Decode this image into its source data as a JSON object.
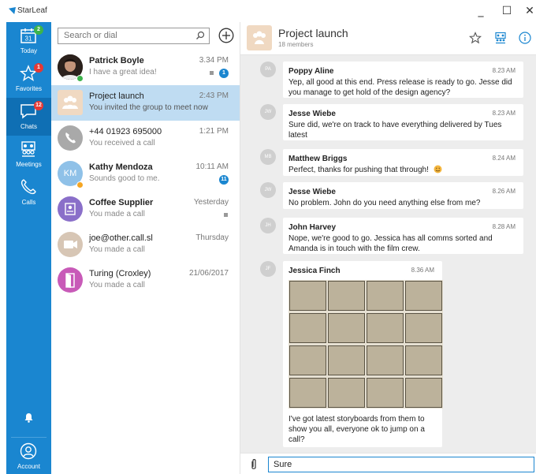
{
  "app": {
    "title": "StarLeaf"
  },
  "window": {
    "minimize": "_",
    "maximize": "☐",
    "close": "✕"
  },
  "rail": {
    "items": [
      {
        "id": "today",
        "label": "Today",
        "icon": "calendar-icon",
        "badge": "2",
        "day": "31"
      },
      {
        "id": "favorites",
        "label": "Favorites",
        "icon": "star-icon",
        "badge": "1"
      },
      {
        "id": "chats",
        "label": "Chats",
        "icon": "chat-bubble-icon",
        "badge": "12"
      },
      {
        "id": "meetings",
        "label": "Meetings",
        "icon": "meeting-room-icon"
      },
      {
        "id": "calls",
        "label": "Calls",
        "icon": "phone-icon"
      }
    ],
    "account_label": "Account"
  },
  "search": {
    "placeholder": "Search or dial"
  },
  "conversations": [
    {
      "name": "Patrick Boyle",
      "preview": "I have a great idea!",
      "time": "3.34 PM",
      "unread": "1",
      "avatar": "photo"
    },
    {
      "name": "Project launch",
      "preview": "You invited the group to meet now",
      "time": "2:43 PM",
      "avatar": "group"
    },
    {
      "name": "+44 01923 695000",
      "preview": "You received a call",
      "time": "1:21 PM",
      "avatar": "phone"
    },
    {
      "name": "Kathy Mendoza",
      "preview": "Sounds good to me.",
      "time": "10:11 AM",
      "unread": "11",
      "avatar": "initials",
      "initials": "KM"
    },
    {
      "name": "Coffee Supplier",
      "preview": "You made a call",
      "time": "Yesterday",
      "avatar": "device"
    },
    {
      "name": "joe@other.call.sl",
      "preview": "You made a call",
      "time": "Thursday",
      "avatar": "video"
    },
    {
      "name": "Turing (Croxley)",
      "preview": "You made a call",
      "time": "21/06/2017",
      "avatar": "room"
    }
  ],
  "chat": {
    "title": "Project launch",
    "subtitle": "18 members",
    "messages": [
      {
        "initials": "PA",
        "sender": "Poppy Aline",
        "time": "8.23 AM",
        "lines": [
          "Yep, all good at this end. Press release is ready to go. Jesse did",
          "you manage to get hold of the design agency?"
        ]
      },
      {
        "initials": "JW",
        "sender": "Jesse Wiebe",
        "time": "8.23 AM",
        "lines": [
          "Sure did, we're on track to have everything delivered by Tues",
          "latest"
        ]
      },
      {
        "initials": "MB",
        "sender": "Matthew Briggs",
        "time": "8.24 AM",
        "lines": [
          "Perfect, thanks for pushing that through!"
        ]
      },
      {
        "initials": "JW",
        "sender": "Jesse Wiebe",
        "time": "8.26 AM",
        "lines": [
          "No problem. John do you need anything else from me?"
        ]
      },
      {
        "initials": "JH",
        "sender": "John Harvey",
        "time": "8.28 AM",
        "lines": [
          "Nope, we're good to go. Jessica has all comms sorted and",
          "Amanda is in touch with the film crew."
        ]
      },
      {
        "initials": "JF",
        "sender": "Jessica Finch",
        "time": "8.36 AM",
        "lines": [
          "I've got latest storyboards from them to",
          "show you all, everyone ok to jump on a",
          "call?"
        ]
      }
    ],
    "composer_value": "Sure"
  }
}
